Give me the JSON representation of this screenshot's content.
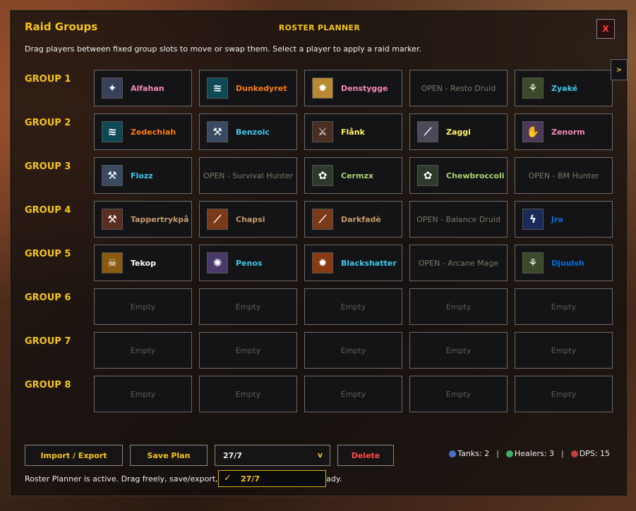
{
  "header": {
    "title": "Raid Groups",
    "subtitle": "ROSTER PLANNER",
    "close_label": "X"
  },
  "instructions": "Drag players between fixed group slots to move or swap them. Select a player to apply a raid marker.",
  "next_arrow_label": ">",
  "groups": [
    {
      "label": "GROUP 1",
      "slots": [
        {
          "type": "player",
          "name": "Alfahan",
          "color": "#f48cba",
          "icon": "holy-priest-icon",
          "icon_color": "#39405a",
          "glyph": "✦"
        },
        {
          "type": "player",
          "name": "Dunkedyret",
          "color": "#ff7c0a",
          "icon": "bear-claw-icon",
          "icon_color": "#0d4a56",
          "glyph": "≋"
        },
        {
          "type": "player",
          "name": "Denstygge",
          "color": "#f48cba",
          "icon": "holy-light-icon",
          "icon_color": "#b98a32",
          "glyph": "✸"
        },
        {
          "type": "open",
          "text": "OPEN - Resto Druid"
        },
        {
          "type": "player",
          "name": "Zyaké",
          "color": "#3fc7eb",
          "icon": "nature-totem-icon",
          "icon_color": "#3c4a2a",
          "glyph": "⚘"
        }
      ]
    },
    {
      "label": "GROUP 2",
      "slots": [
        {
          "type": "player",
          "name": "Zedechiah",
          "color": "#ff7c0a",
          "icon": "bear-claw-icon",
          "icon_color": "#0d4a56",
          "glyph": "≋"
        },
        {
          "type": "player",
          "name": "Benzoic",
          "color": "#3fc7eb",
          "icon": "frost-axe-icon",
          "icon_color": "#3a4a62",
          "glyph": "⚒"
        },
        {
          "type": "player",
          "name": "Flånk",
          "color": "#fff468",
          "icon": "rogue-blade-icon",
          "icon_color": "#4a2e22",
          "glyph": "⚔"
        },
        {
          "type": "player",
          "name": "Zaggi",
          "color": "#fff468",
          "icon": "dagger-strike-icon",
          "icon_color": "#4a4a58",
          "glyph": "⟋"
        },
        {
          "type": "player",
          "name": "Zenorm",
          "color": "#f48cba",
          "icon": "shadow-hand-icon",
          "icon_color": "#4c3a5a",
          "glyph": "✋"
        }
      ]
    },
    {
      "label": "GROUP 3",
      "slots": [
        {
          "type": "player",
          "name": "Flozz",
          "color": "#3fc7eb",
          "icon": "frost-axe-icon",
          "icon_color": "#3a4a62",
          "glyph": "⚒"
        },
        {
          "type": "open",
          "text": "OPEN - Survival Hunter"
        },
        {
          "type": "player",
          "name": "Cermzx",
          "color": "#aad372",
          "icon": "beast-paw-icon",
          "icon_color": "#2e3a2a",
          "glyph": "✿"
        },
        {
          "type": "player",
          "name": "Chewbroccoli",
          "color": "#aad372",
          "icon": "beast-paw-icon",
          "icon_color": "#2e3a2a",
          "glyph": "✿"
        },
        {
          "type": "open",
          "text": "OPEN - BM Hunter"
        }
      ]
    },
    {
      "label": "GROUP 4",
      "slots": [
        {
          "type": "player",
          "name": "Tappertrykpå",
          "color": "#c69b6d",
          "icon": "warrior-axe-icon",
          "icon_color": "#5a2e20",
          "glyph": "⚒"
        },
        {
          "type": "player",
          "name": "Chapsi",
          "color": "#c69b6d",
          "icon": "slash-strike-icon",
          "icon_color": "#7a3a1a",
          "glyph": "⟋"
        },
        {
          "type": "player",
          "name": "Darkfadè",
          "color": "#c69b6d",
          "icon": "slash-strike-icon",
          "icon_color": "#7a3a1a",
          "glyph": "⟋"
        },
        {
          "type": "open",
          "text": "OPEN - Balance Druid"
        },
        {
          "type": "player",
          "name": "Jra",
          "color": "#0070dd",
          "icon": "lightning-bolt-icon",
          "icon_color": "#1a2a5a",
          "glyph": "ϟ"
        }
      ]
    },
    {
      "label": "GROUP 5",
      "slots": [
        {
          "type": "player",
          "name": "Tekop",
          "color": "#ffffff",
          "icon": "skull-icon",
          "icon_color": "#8a5a10",
          "glyph": "☠"
        },
        {
          "type": "player",
          "name": "Penos",
          "color": "#3fc7eb",
          "icon": "arcane-circle-icon",
          "icon_color": "#4a3a6a",
          "glyph": "✺"
        },
        {
          "type": "player",
          "name": "Blackshatter",
          "color": "#3fc7eb",
          "icon": "fire-blast-icon",
          "icon_color": "#8a3a10",
          "glyph": "✹"
        },
        {
          "type": "open",
          "text": "OPEN - Arcane Mage"
        },
        {
          "type": "player",
          "name": "Djuulsh",
          "color": "#0070dd",
          "icon": "nature-totem-icon",
          "icon_color": "#3c4a2a",
          "glyph": "⚘"
        }
      ]
    },
    {
      "label": "GROUP 6",
      "slots": [
        {
          "type": "empty",
          "text": "Empty"
        },
        {
          "type": "empty",
          "text": "Empty"
        },
        {
          "type": "empty",
          "text": "Empty"
        },
        {
          "type": "empty",
          "text": "Empty"
        },
        {
          "type": "empty",
          "text": "Empty"
        }
      ]
    },
    {
      "label": "GROUP 7",
      "slots": [
        {
          "type": "empty",
          "text": "Empty"
        },
        {
          "type": "empty",
          "text": "Empty"
        },
        {
          "type": "empty",
          "text": "Empty"
        },
        {
          "type": "empty",
          "text": "Empty"
        },
        {
          "type": "empty",
          "text": "Empty"
        }
      ]
    },
    {
      "label": "GROUP 8",
      "slots": [
        {
          "type": "empty",
          "text": "Empty"
        },
        {
          "type": "empty",
          "text": "Empty"
        },
        {
          "type": "empty",
          "text": "Empty"
        },
        {
          "type": "empty",
          "text": "Empty"
        },
        {
          "type": "empty",
          "text": "Empty"
        }
      ]
    }
  ],
  "toolbar": {
    "import_export_label": "Import / Export",
    "save_plan_label": "Save Plan",
    "plan_select_value": "27/7",
    "plan_select_chevron": "v",
    "delete_label": "Delete"
  },
  "dropdown_menu": {
    "selected_option": "27/7",
    "check_icon": "checkmark-icon"
  },
  "role_counts": {
    "tanks_label": "Tanks: 2",
    "healers_label": "Healers: 3",
    "dps_label": "DPS: 15",
    "separator": "|"
  },
  "status_text": "Roster Planner is active. Drag freely, save/export, then Apply Groups when ready.",
  "colors": {
    "accent_gold": "#f5c518",
    "danger_red": "#ff4a4a"
  }
}
